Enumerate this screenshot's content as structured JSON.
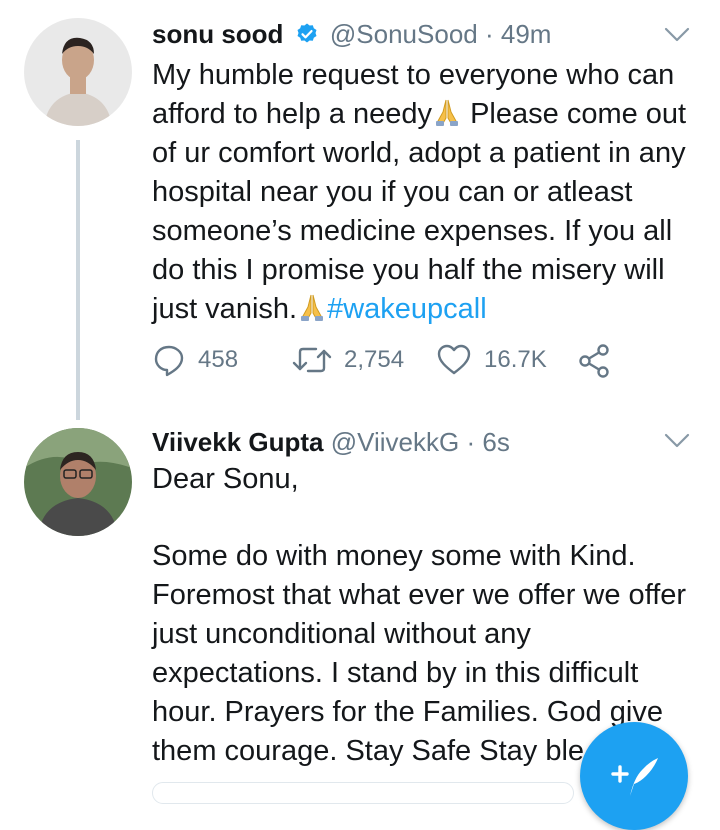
{
  "tweet1": {
    "display_name": "sonu sood",
    "handle": "@SonuSood",
    "time": "· 49m",
    "text_parts": [
      "My humble request to everyone who can afford to help a needy",
      " Please come out of ur comfort world, adopt a patient in any hospital near you if you can or atleast someone’s medicine expenses. If you all do this I promise you half the misery will just vanish.",
      "#wakeupcall"
    ],
    "replies": "458",
    "retweets": "2,754",
    "likes": "16.7K"
  },
  "tweet2": {
    "display_name": "Viivekk Gupta",
    "handle": "@ViivekkG",
    "time": "· 6s",
    "greeting": "Dear Sonu,",
    "text": "Some do with money some with Kind. Foremost that what ever we offer we offer just unconditional without any expectations. I stand by in this difficult hour. Prayers for the Families. God give them courage. Stay Safe Stay ble"
  },
  "icons": {
    "verified": "verified-badge-icon",
    "chevron": "chevron-down-icon",
    "reply": "reply-bubble-icon",
    "retweet": "retweet-icon",
    "like": "heart-icon",
    "share": "share-icon",
    "compose": "compose-tweet-icon",
    "emoji": "folded-hands-emoji"
  },
  "colors": {
    "accent": "#1da1f2",
    "text": "#14171a",
    "secondary": "#657786",
    "thread_line": "#ccd6dd"
  }
}
